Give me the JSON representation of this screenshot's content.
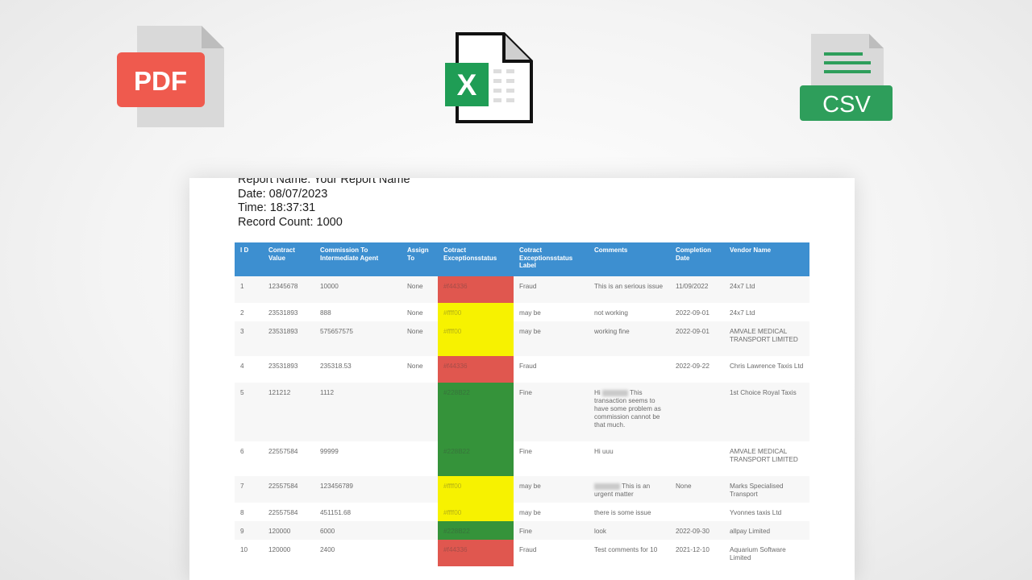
{
  "icons": {
    "pdf": {
      "label": "PDF",
      "color": "#ef5a4e",
      "page_color": "#d9d9d9"
    },
    "excel": {
      "label": "X",
      "color": "#1f9d55"
    },
    "csv": {
      "label": "CSV",
      "color": "#2e9e5b",
      "page_color": "#d9d9d9"
    }
  },
  "report": {
    "name_line": "Report Name: Your Report Name",
    "date_line": "Date: 08/07/2023",
    "time_line": "Time: 18:37:31",
    "count_line": "Record Count: 1000"
  },
  "table": {
    "header_color": "#3d8fd0",
    "columns": [
      "I D",
      "Contract Value",
      "Commission To Intermediate Agent",
      "Assign To",
      "Cotract Exceptionsstatus",
      "Cotract Exceptionsstatus Label",
      "Comments",
      "Completion Date",
      "Vendor Name"
    ],
    "status_colors": {
      "red": "#e0574f",
      "yellow": "#f7f200",
      "green": "#35933a"
    },
    "rows": [
      {
        "id": "1",
        "value": "12345678",
        "commission": "10000",
        "assign": "None",
        "status": "#f44336",
        "status_kind": "red",
        "label": "Fraud",
        "comments": "This is an serious issue",
        "comment_blur": false,
        "date": "11/09/2022",
        "vendor": "24x7 Ltd"
      },
      {
        "id": "2",
        "value": "23531893",
        "commission": "888",
        "assign": "None",
        "status": "#ffff00",
        "status_kind": "yellow",
        "label": "may be",
        "comments": "not working",
        "comment_blur": false,
        "date": "2022-09-01",
        "vendor": "24x7 Ltd"
      },
      {
        "id": "3",
        "value": "23531893",
        "commission": "575657575",
        "assign": "None",
        "status": "#ffff00",
        "status_kind": "yellow",
        "label": "may be",
        "comments": "working fine",
        "comment_blur": false,
        "date": "2022-09-01",
        "vendor": "AMVALE MEDICAL TRANSPORT LIMITED"
      },
      {
        "id": "4",
        "value": "23531893",
        "commission": "235318.53",
        "assign": "None",
        "status": "#f44336",
        "status_kind": "red",
        "label": "Fraud",
        "comments": "",
        "comment_blur": false,
        "date": "2022-09-22",
        "vendor": "Chris Lawrence Taxis Ltd"
      },
      {
        "id": "5",
        "value": "121212",
        "commission": "1112",
        "assign": "",
        "status": "#228B22",
        "status_kind": "green",
        "label": "Fine",
        "comments_prefix": "Hi",
        "comments": "This transaction seems to have some problem as commission cannot be that much.",
        "comment_blur": true,
        "date": "",
        "vendor": "1st Choice Royal Taxis"
      },
      {
        "id": "6",
        "value": "22557584",
        "commission": "99999",
        "assign": "",
        "status": "#228B22",
        "status_kind": "green",
        "label": "Fine",
        "comments": "Hi uuu",
        "comment_blur": false,
        "date": "",
        "vendor": "AMVALE MEDICAL TRANSPORT LIMITED"
      },
      {
        "id": "7",
        "value": "22557584",
        "commission": "123456789",
        "assign": "",
        "status": "#ffff00",
        "status_kind": "yellow",
        "label": "may be",
        "comments_prefix": "",
        "comments": "This is an urgent matter",
        "comment_blur": true,
        "date": "None",
        "vendor": "Marks Specialised Transport"
      },
      {
        "id": "8",
        "value": "22557584",
        "commission": "451151.68",
        "assign": "",
        "status": "#ffff00",
        "status_kind": "yellow",
        "label": "may be",
        "comments": "there is some issue",
        "comment_blur": false,
        "date": "",
        "vendor": "Yvonnes taxis Ltd"
      },
      {
        "id": "9",
        "value": "120000",
        "commission": "6000",
        "assign": "",
        "status": "#228B22",
        "status_kind": "green",
        "label": "Fine",
        "comments": "look",
        "comment_blur": false,
        "date": "2022-09-30",
        "vendor": "allpay Limited"
      },
      {
        "id": "10",
        "value": "120000",
        "commission": "2400",
        "assign": "",
        "status": "#f44336",
        "status_kind": "red",
        "label": "Fraud",
        "comments": "Test comments for 10",
        "comment_blur": false,
        "date": "2021-12-10",
        "vendor": "Aquarium Software Limited"
      }
    ]
  }
}
